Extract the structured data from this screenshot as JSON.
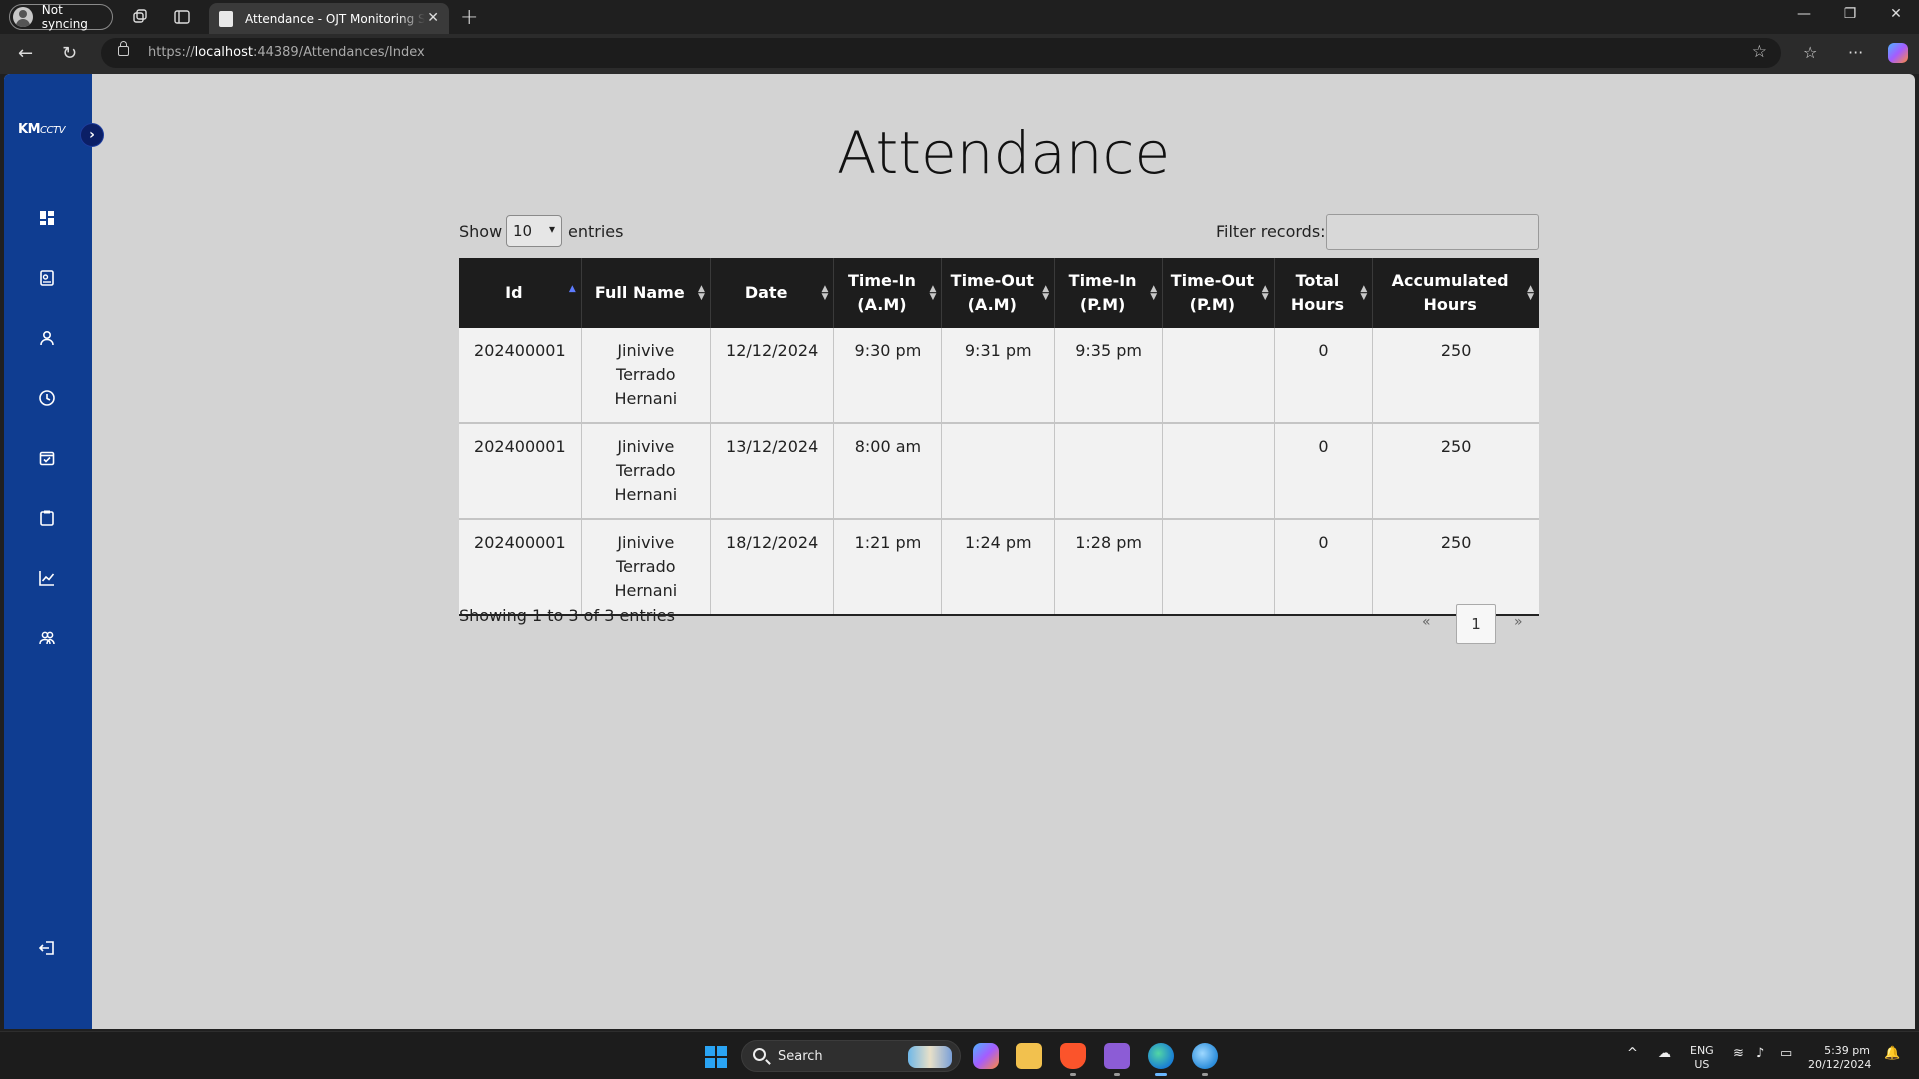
{
  "browser": {
    "profile_label": "Not syncing",
    "tab_title": "Attendance - OJT Monitoring System",
    "url_scheme": "https://",
    "url_host": "localhost",
    "url_rest": ":44389/Attendances/Index"
  },
  "sidebar": {
    "logo_bold": "KM",
    "logo_italic": "CCTV",
    "expand_icon": "chevron-right-icon",
    "items": [
      {
        "icon": "dashboard-icon"
      },
      {
        "icon": "id-card-icon"
      },
      {
        "icon": "person-icon"
      },
      {
        "icon": "clock-icon"
      },
      {
        "icon": "calendar-check-icon"
      },
      {
        "icon": "clipboard-icon"
      },
      {
        "icon": "chart-line-icon"
      },
      {
        "icon": "users-icon"
      }
    ],
    "logout_icon": "logout-icon"
  },
  "page": {
    "title": "Attendance",
    "show_label": "Show",
    "page_length": "10",
    "entries_label": "entries",
    "filter_label": "Filter records:",
    "filter_value": ""
  },
  "table": {
    "headers": [
      "Id",
      "Full Name",
      "Date",
      "Time-In (A.M)",
      "Time-Out (A.M)",
      "Time-In (P.M)",
      "Time-Out (P.M)",
      "Total Hours",
      "Accumulated Hours"
    ],
    "rows": [
      [
        "202400001",
        "Jinivive Terrado Hernani",
        "12/12/2024",
        "9:30 pm",
        "9:31 pm",
        "9:35 pm",
        "",
        "0",
        "250"
      ],
      [
        "202400001",
        "Jinivive Terrado Hernani",
        "13/12/2024",
        "8:00 am",
        "",
        "",
        "",
        "0",
        "250"
      ],
      [
        "202400001",
        "Jinivive Terrado Hernani",
        "18/12/2024",
        "1:21 pm",
        "1:24 pm",
        "1:28 pm",
        "",
        "0",
        "250"
      ]
    ]
  },
  "footer": {
    "info": "Showing 1 to 3 of 3 entries",
    "prev": "«",
    "current_page": "1",
    "next": "»"
  },
  "taskbar": {
    "search_placeholder": "Search",
    "lang_line1": "ENG",
    "lang_line2": "US",
    "time": "5:39 pm",
    "date": "20/12/2024"
  },
  "colors": {
    "sidebar": "#0f3d91",
    "table_header": "#1d1d1d",
    "page_bg": "#d3d3d3"
  }
}
